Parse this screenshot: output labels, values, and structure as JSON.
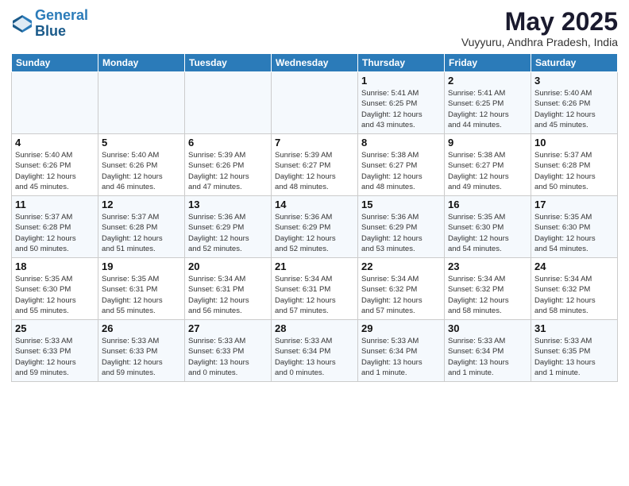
{
  "header": {
    "logo_line1": "General",
    "logo_line2": "Blue",
    "month_year": "May 2025",
    "location": "Vuyyuru, Andhra Pradesh, India"
  },
  "weekdays": [
    "Sunday",
    "Monday",
    "Tuesday",
    "Wednesday",
    "Thursday",
    "Friday",
    "Saturday"
  ],
  "weeks": [
    [
      {
        "day": "",
        "info": ""
      },
      {
        "day": "",
        "info": ""
      },
      {
        "day": "",
        "info": ""
      },
      {
        "day": "",
        "info": ""
      },
      {
        "day": "1",
        "info": "Sunrise: 5:41 AM\nSunset: 6:25 PM\nDaylight: 12 hours\nand 43 minutes."
      },
      {
        "day": "2",
        "info": "Sunrise: 5:41 AM\nSunset: 6:25 PM\nDaylight: 12 hours\nand 44 minutes."
      },
      {
        "day": "3",
        "info": "Sunrise: 5:40 AM\nSunset: 6:26 PM\nDaylight: 12 hours\nand 45 minutes."
      }
    ],
    [
      {
        "day": "4",
        "info": "Sunrise: 5:40 AM\nSunset: 6:26 PM\nDaylight: 12 hours\nand 45 minutes."
      },
      {
        "day": "5",
        "info": "Sunrise: 5:40 AM\nSunset: 6:26 PM\nDaylight: 12 hours\nand 46 minutes."
      },
      {
        "day": "6",
        "info": "Sunrise: 5:39 AM\nSunset: 6:26 PM\nDaylight: 12 hours\nand 47 minutes."
      },
      {
        "day": "7",
        "info": "Sunrise: 5:39 AM\nSunset: 6:27 PM\nDaylight: 12 hours\nand 48 minutes."
      },
      {
        "day": "8",
        "info": "Sunrise: 5:38 AM\nSunset: 6:27 PM\nDaylight: 12 hours\nand 48 minutes."
      },
      {
        "day": "9",
        "info": "Sunrise: 5:38 AM\nSunset: 6:27 PM\nDaylight: 12 hours\nand 49 minutes."
      },
      {
        "day": "10",
        "info": "Sunrise: 5:37 AM\nSunset: 6:28 PM\nDaylight: 12 hours\nand 50 minutes."
      }
    ],
    [
      {
        "day": "11",
        "info": "Sunrise: 5:37 AM\nSunset: 6:28 PM\nDaylight: 12 hours\nand 50 minutes."
      },
      {
        "day": "12",
        "info": "Sunrise: 5:37 AM\nSunset: 6:28 PM\nDaylight: 12 hours\nand 51 minutes."
      },
      {
        "day": "13",
        "info": "Sunrise: 5:36 AM\nSunset: 6:29 PM\nDaylight: 12 hours\nand 52 minutes."
      },
      {
        "day": "14",
        "info": "Sunrise: 5:36 AM\nSunset: 6:29 PM\nDaylight: 12 hours\nand 52 minutes."
      },
      {
        "day": "15",
        "info": "Sunrise: 5:36 AM\nSunset: 6:29 PM\nDaylight: 12 hours\nand 53 minutes."
      },
      {
        "day": "16",
        "info": "Sunrise: 5:35 AM\nSunset: 6:30 PM\nDaylight: 12 hours\nand 54 minutes."
      },
      {
        "day": "17",
        "info": "Sunrise: 5:35 AM\nSunset: 6:30 PM\nDaylight: 12 hours\nand 54 minutes."
      }
    ],
    [
      {
        "day": "18",
        "info": "Sunrise: 5:35 AM\nSunset: 6:30 PM\nDaylight: 12 hours\nand 55 minutes."
      },
      {
        "day": "19",
        "info": "Sunrise: 5:35 AM\nSunset: 6:31 PM\nDaylight: 12 hours\nand 55 minutes."
      },
      {
        "day": "20",
        "info": "Sunrise: 5:34 AM\nSunset: 6:31 PM\nDaylight: 12 hours\nand 56 minutes."
      },
      {
        "day": "21",
        "info": "Sunrise: 5:34 AM\nSunset: 6:31 PM\nDaylight: 12 hours\nand 57 minutes."
      },
      {
        "day": "22",
        "info": "Sunrise: 5:34 AM\nSunset: 6:32 PM\nDaylight: 12 hours\nand 57 minutes."
      },
      {
        "day": "23",
        "info": "Sunrise: 5:34 AM\nSunset: 6:32 PM\nDaylight: 12 hours\nand 58 minutes."
      },
      {
        "day": "24",
        "info": "Sunrise: 5:34 AM\nSunset: 6:32 PM\nDaylight: 12 hours\nand 58 minutes."
      }
    ],
    [
      {
        "day": "25",
        "info": "Sunrise: 5:33 AM\nSunset: 6:33 PM\nDaylight: 12 hours\nand 59 minutes."
      },
      {
        "day": "26",
        "info": "Sunrise: 5:33 AM\nSunset: 6:33 PM\nDaylight: 12 hours\nand 59 minutes."
      },
      {
        "day": "27",
        "info": "Sunrise: 5:33 AM\nSunset: 6:33 PM\nDaylight: 13 hours\nand 0 minutes."
      },
      {
        "day": "28",
        "info": "Sunrise: 5:33 AM\nSunset: 6:34 PM\nDaylight: 13 hours\nand 0 minutes."
      },
      {
        "day": "29",
        "info": "Sunrise: 5:33 AM\nSunset: 6:34 PM\nDaylight: 13 hours\nand 1 minute."
      },
      {
        "day": "30",
        "info": "Sunrise: 5:33 AM\nSunset: 6:34 PM\nDaylight: 13 hours\nand 1 minute."
      },
      {
        "day": "31",
        "info": "Sunrise: 5:33 AM\nSunset: 6:35 PM\nDaylight: 13 hours\nand 1 minute."
      }
    ]
  ]
}
